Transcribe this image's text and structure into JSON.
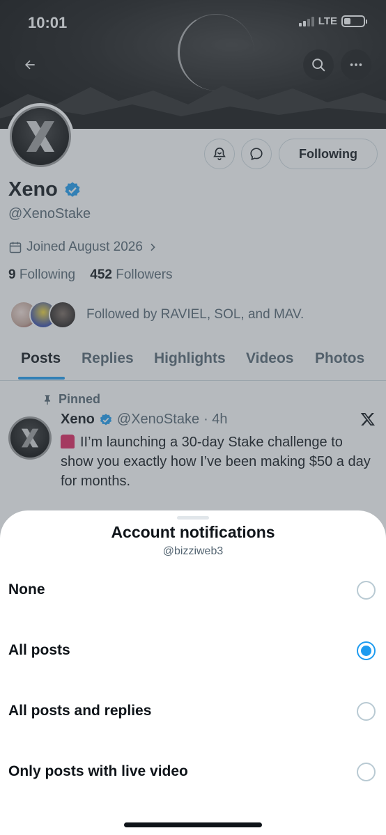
{
  "status_bar": {
    "time": "10:01",
    "network": "LTE"
  },
  "header": {
    "back_icon": "arrow-left-icon",
    "search_icon": "search-icon",
    "more_icon": "more-horizontal-icon"
  },
  "profile": {
    "name": "Xeno",
    "verified": true,
    "handle": "@XenoStake",
    "joined": "Joined August 2026",
    "following_count": "9",
    "following_label": "Following",
    "followers_count": "452",
    "followers_label": "Followers",
    "followed_by": "Followed by RAVIEL, SOL, and MAV.",
    "following_button": "Following"
  },
  "tabs": [
    "Posts",
    "Replies",
    "Highlights",
    "Videos",
    "Photos"
  ],
  "active_tab": "Posts",
  "pinned_post": {
    "pinned_label": "Pinned",
    "author": "Xeno",
    "handle": "@XenoStake",
    "time": "· 4h",
    "text": "II’m launching a 30-day Stake challenge to show you exactly how I’ve been making $50 a day for months."
  },
  "sheet": {
    "title": "Account notifications",
    "subtitle": "@bizziweb3",
    "options": [
      {
        "label": "None",
        "selected": false
      },
      {
        "label": "All posts",
        "selected": true
      },
      {
        "label": "All posts and replies",
        "selected": false
      },
      {
        "label": "Only posts with live video",
        "selected": false
      }
    ]
  },
  "colors": {
    "accent": "#1d9bf0",
    "text": "#0f1419",
    "muted": "#536471",
    "border": "#cfd9de"
  }
}
